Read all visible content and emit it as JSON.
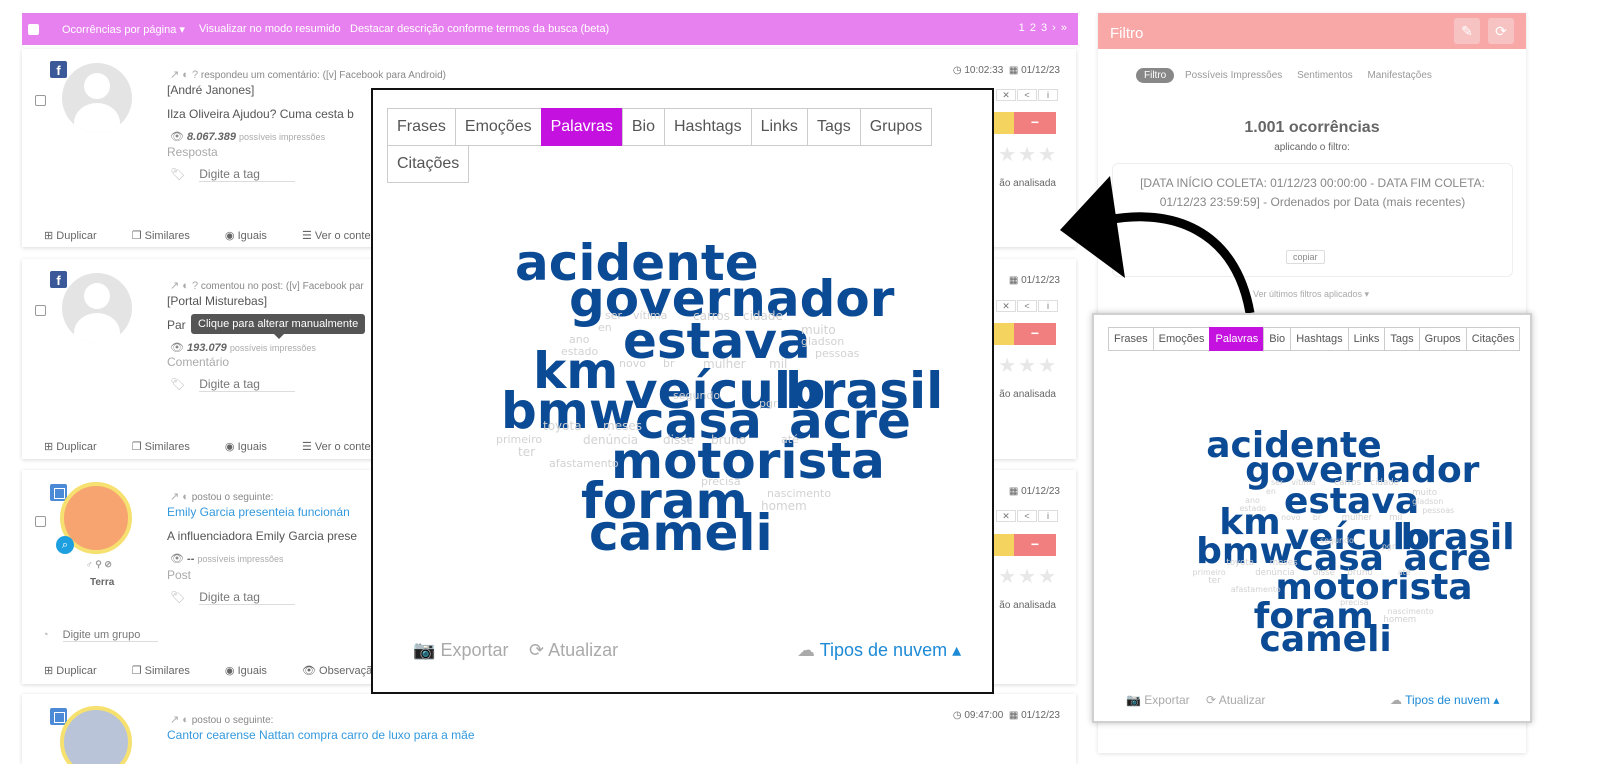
{
  "topbar": {
    "per_page": "Ocorrências por página ▾",
    "summary_mode": "Visualizar no modo resumido",
    "highlight": "Destacar descrição conforme termos da busca (beta)",
    "pager": "1 2 3 › »"
  },
  "posts": [
    {
      "meta": "respondeu um comentário: ([v] Facebook para Android)",
      "author": "[André Janones]",
      "content": "Ilza Oliveira Ajudou? Cuma cesta b",
      "impressions": "8.067.389",
      "impressions_label": "possíveis impressões",
      "type": "Resposta",
      "tag_placeholder": "Digite a tag",
      "time": "10:02:33",
      "date": "01/12/23",
      "status": "ão analisada",
      "actions": [
        "Duplicar",
        "Similares",
        "Iguais",
        "Ver o contexto"
      ]
    },
    {
      "meta": "comentou no post: ([v] Facebook par",
      "author": "[Portal Misturebas]",
      "content": "Par",
      "impressions": "193.079",
      "impressions_label": "possíveis impressões",
      "type": "Comentário",
      "tag_placeholder": "Digite a tag",
      "date": "01/12/23",
      "status": "ão analisada",
      "actions": [
        "Duplicar",
        "Similares",
        "Iguais",
        "Ver o contexto"
      ]
    },
    {
      "meta": "postou o seguinte:",
      "title": "Emily Garcia presenteia funcionán",
      "content": "A influenciadora Emily Garcia prese",
      "impressions": "--",
      "impressions_label": "possíveis impressões",
      "type": "Post",
      "tag_placeholder": "Digite a tag",
      "source": "Terra",
      "group_placeholder": "Digite um grupo",
      "date": "01/12/23",
      "status": "ão analisada",
      "actions": [
        "Duplicar",
        "Similares",
        "Iguais",
        "Observação"
      ]
    },
    {
      "meta": "postou o seguinte:",
      "title": "Cantor cearense Nattan compra carro de luxo para a mãe",
      "time": "09:47:00",
      "date": "01/12/23"
    }
  ],
  "tooltip": "Clique para alterar manualmente",
  "filter": {
    "title": "Filtro",
    "tabs": [
      "Filtro",
      "Possíveis Impressões",
      "Sentimentos",
      "Manifestações"
    ],
    "occurrences": "1.001 ocorrências",
    "applying": "aplicando o filtro:",
    "description": "[DATA INÍCIO COLETA: 01/12/23 00:00:00 - DATA FIM COLETA: 01/12/23 23:59:59] - Ordenados por Data (mais recentes)",
    "copy": "copiar",
    "last_filters": "Ver últimos filtros aplicados ▾"
  },
  "cloud": {
    "tabs": [
      "Frases",
      "Emoções",
      "Palavras",
      "Bio",
      "Hashtags",
      "Links",
      "Tags",
      "Grupos",
      "Citações"
    ],
    "active_tab": "Palavras",
    "export": "Exportar",
    "refresh": "Atualizar",
    "cloud_types": "Tipos de nuvem ▴",
    "big_words": [
      "acidente",
      "governador",
      "estava",
      "km",
      "veículo",
      "brasil",
      "bmw",
      "casa",
      "acre",
      "motorista",
      "foram",
      "cameli"
    ],
    "small_words": [
      "ser",
      "vítima",
      "carros",
      "cidade",
      "en",
      "ano",
      "estado",
      "muito",
      "gladson",
      "pessoas",
      "novo",
      "br",
      "mulher",
      "mil",
      "pgr",
      "toyota",
      "meses",
      "primeiro",
      "denúncia",
      "disse",
      "bruno",
      "até",
      "ter",
      "afastamento",
      "precisa",
      "nascimento",
      "homem",
      "segundo"
    ]
  },
  "colors": {
    "accent": "#c411e0",
    "topbar": "#e881f0",
    "filter_header": "#f9a8a8",
    "word_primary": "#0b4a94",
    "link": "#1d8ad6"
  }
}
